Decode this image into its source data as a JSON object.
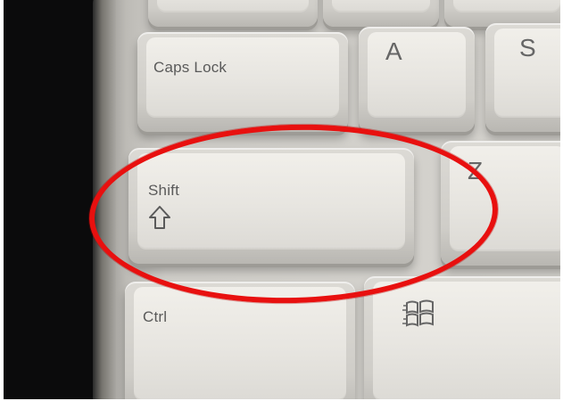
{
  "keys": {
    "caps_lock": "Caps Lock",
    "a": "A",
    "s": "S",
    "shift": "Shift",
    "z": "Z",
    "ctrl": "Ctrl"
  },
  "icons": {
    "shift_arrow": "shift-up-arrow-icon",
    "windows_logo": "windows-logo-icon"
  },
  "colors": {
    "highlight_ring": "#e8100f",
    "key_surface": "#e9e7e2",
    "legend_text": "#5a5a5a"
  }
}
